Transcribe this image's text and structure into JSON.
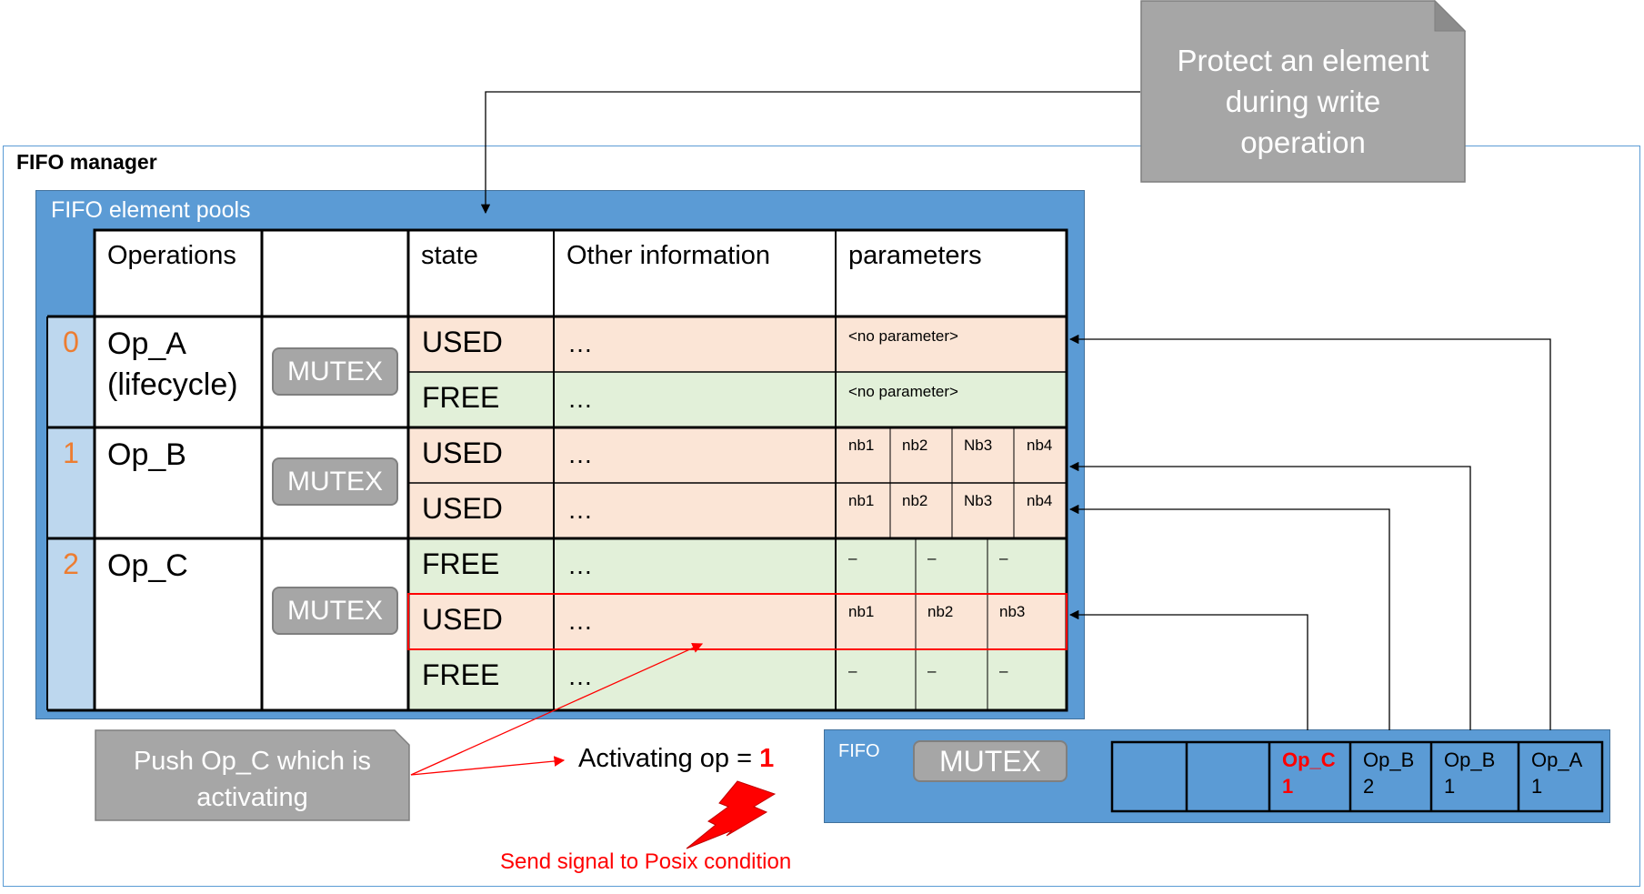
{
  "manager_title": "FIFO manager",
  "pools": {
    "title": "FIFO element pools",
    "headers": [
      "Operations",
      "",
      "state",
      "Other information",
      "parameters"
    ],
    "rows": [
      {
        "index": "0",
        "operation_line1": "Op_A",
        "operation_line2": "(lifecycle)",
        "mutex": "MUTEX",
        "elements": [
          {
            "state": "USED",
            "other": "…",
            "params": [
              "<no parameter>"
            ]
          },
          {
            "state": "FREE",
            "other": "…",
            "params": [
              "<no parameter>"
            ]
          }
        ]
      },
      {
        "index": "1",
        "operation_line1": "Op_B",
        "operation_line2": "",
        "mutex": "MUTEX",
        "elements": [
          {
            "state": "USED",
            "other": "…",
            "params": [
              "nb1",
              "nb2",
              "Nb3",
              "nb4"
            ]
          },
          {
            "state": "USED",
            "other": "…",
            "params": [
              "nb1",
              "nb2",
              "Nb3",
              "nb4"
            ]
          }
        ]
      },
      {
        "index": "2",
        "operation_line1": "Op_C",
        "operation_line2": "",
        "mutex": "MUTEX",
        "elements": [
          {
            "state": "FREE",
            "other": "…",
            "params": [
              "–",
              "–",
              "–"
            ]
          },
          {
            "state": "USED",
            "other": "…",
            "params": [
              "nb1",
              "nb2",
              "nb3"
            ]
          },
          {
            "state": "FREE",
            "other": "…",
            "params": [
              "–",
              "–",
              "–"
            ]
          }
        ]
      }
    ]
  },
  "callout_protect": {
    "line1": "Protect an element",
    "line2": "during write",
    "line3": "operation"
  },
  "callout_push": {
    "line1": "Push Op_C which is",
    "line2": "activating"
  },
  "activating": {
    "label": "Activating op = ",
    "value": "1"
  },
  "signal_label": "Send signal to Posix condition",
  "fifo": {
    "title": "FIFO",
    "mutex": "MUTEX",
    "slots": [
      {
        "op": "",
        "count": ""
      },
      {
        "op": "",
        "count": ""
      },
      {
        "op": "Op_C",
        "count": "1",
        "highlight": true
      },
      {
        "op": "Op_B",
        "count": "2"
      },
      {
        "op": "Op_B",
        "count": "1"
      },
      {
        "op": "Op_A",
        "count": "1"
      }
    ]
  },
  "colors": {
    "used": "#fbe5d6",
    "free": "#e2f0d9",
    "pool_blue": "#5b9bd5",
    "index_orange": "#ed7d31",
    "highlight_red": "#ff0000",
    "callout_gray": "#a6a6a6"
  }
}
